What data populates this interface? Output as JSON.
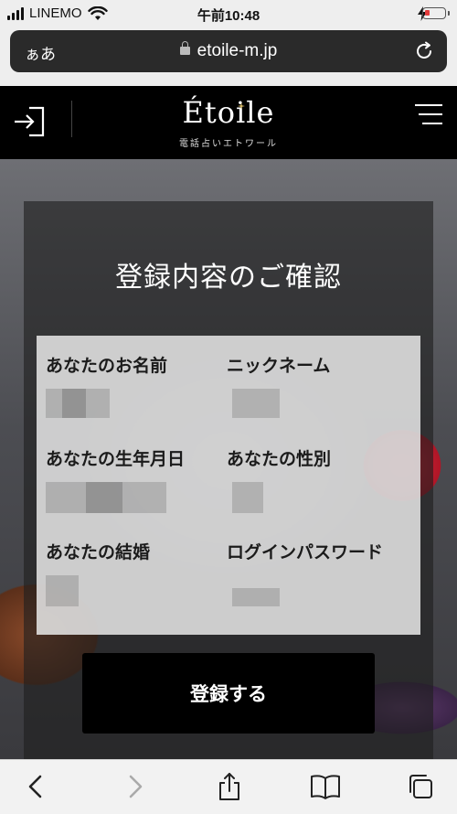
{
  "status_bar": {
    "carrier": "LINEMO",
    "time": "午前10:48"
  },
  "browser": {
    "text_size_label": "ぁあ",
    "domain": "etoile-m.jp"
  },
  "header": {
    "logo": "Étoile",
    "tagline": "電話占いエトワール"
  },
  "page": {
    "title": "登録内容のご確認",
    "fields": [
      {
        "label": "あなたのお名前"
      },
      {
        "label": "ニックネーム"
      },
      {
        "label": "あなたの生年月日"
      },
      {
        "label": "あなたの性別"
      },
      {
        "label": "あなたの結婚"
      },
      {
        "label": "ログインパスワード"
      }
    ],
    "submit_label": "登録する"
  },
  "icons": {
    "login": "login-icon",
    "menu": "menu-icon",
    "reload": "reload-icon",
    "back": "back-icon",
    "forward": "forward-icon",
    "share": "share-icon",
    "bookmarks": "bookmarks-icon",
    "tabs": "tabs-icon"
  },
  "colors": {
    "header_bg": "#000000",
    "button_bg": "#000000",
    "battery_low": "#e23b3b"
  }
}
